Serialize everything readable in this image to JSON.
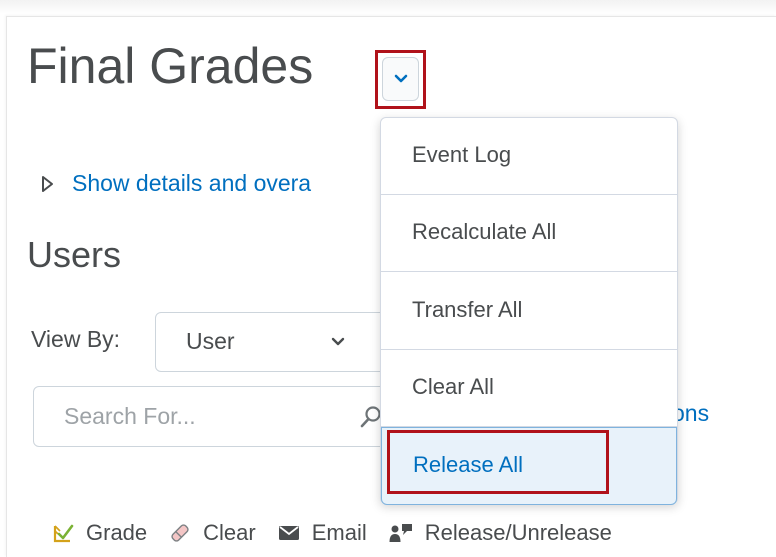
{
  "page": {
    "title": "Final Grades"
  },
  "details": {
    "link_text": "Show details and overa"
  },
  "users": {
    "heading": "Users",
    "view_by_label": "View By:",
    "view_by_value": "User",
    "search_placeholder": "Search For...",
    "options_link_tail": "ons"
  },
  "toolbar": {
    "grade_label": "Grade",
    "clear_label": "Clear",
    "email_label": "Email",
    "release_label": "Release/Unrelease"
  },
  "menu": {
    "items": [
      {
        "label": "Event Log"
      },
      {
        "label": "Recalculate All"
      },
      {
        "label": "Transfer All"
      },
      {
        "label": "Clear All"
      },
      {
        "label": "Release All"
      }
    ]
  },
  "colors": {
    "link": "#006fbf",
    "text": "#494c4e",
    "highlight": "#b0121a",
    "menu_active_bg": "#e8f2fa"
  },
  "icons": {
    "title_dropdown": "chevron-down-icon",
    "details_toggle": "triangle-right-icon",
    "select_chevron": "chevron-down-icon",
    "search": "search-icon",
    "grade": "grade-icon",
    "clear": "eraser-icon",
    "email": "email-icon",
    "release": "release-icon"
  }
}
